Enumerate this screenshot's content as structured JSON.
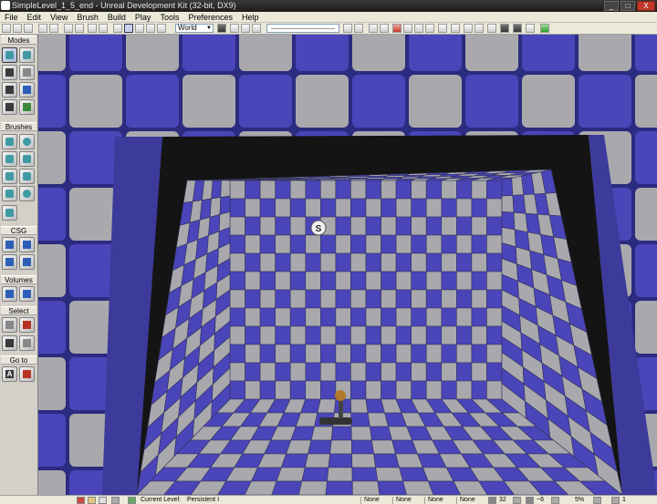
{
  "window": {
    "title": "SimpleLevel_1_5_end - Unreal Development Kit (32-bit, DX9)",
    "controls": [
      "_",
      "□",
      "X"
    ]
  },
  "menu": [
    "File",
    "Edit",
    "View",
    "Brush",
    "Build",
    "Play",
    "Tools",
    "Preferences",
    "Help"
  ],
  "toolbar": {
    "coordinate_system": "World"
  },
  "left_panel": {
    "sections": {
      "modes": "Modes",
      "brushes": "Brushes",
      "csg": "CSG",
      "volumes": "Volumes",
      "select": "Select",
      "goto": "Go to"
    },
    "goto_button_label": "A"
  },
  "viewport": {
    "actor_label": "S"
  },
  "status": {
    "current_level_label": "Current Level:",
    "current_level_value": "Persistent I",
    "slots": [
      "None",
      "None",
      "None",
      "None"
    ],
    "grid_value": "32",
    "rotation_value": "~6",
    "scale_value": "5%",
    "extra_value": "1"
  },
  "colors": {
    "checker_blue": "#4a45b8",
    "checker_gray": "#a9a9ad",
    "frame_dark": "#141414",
    "title_bar": "#262626"
  }
}
